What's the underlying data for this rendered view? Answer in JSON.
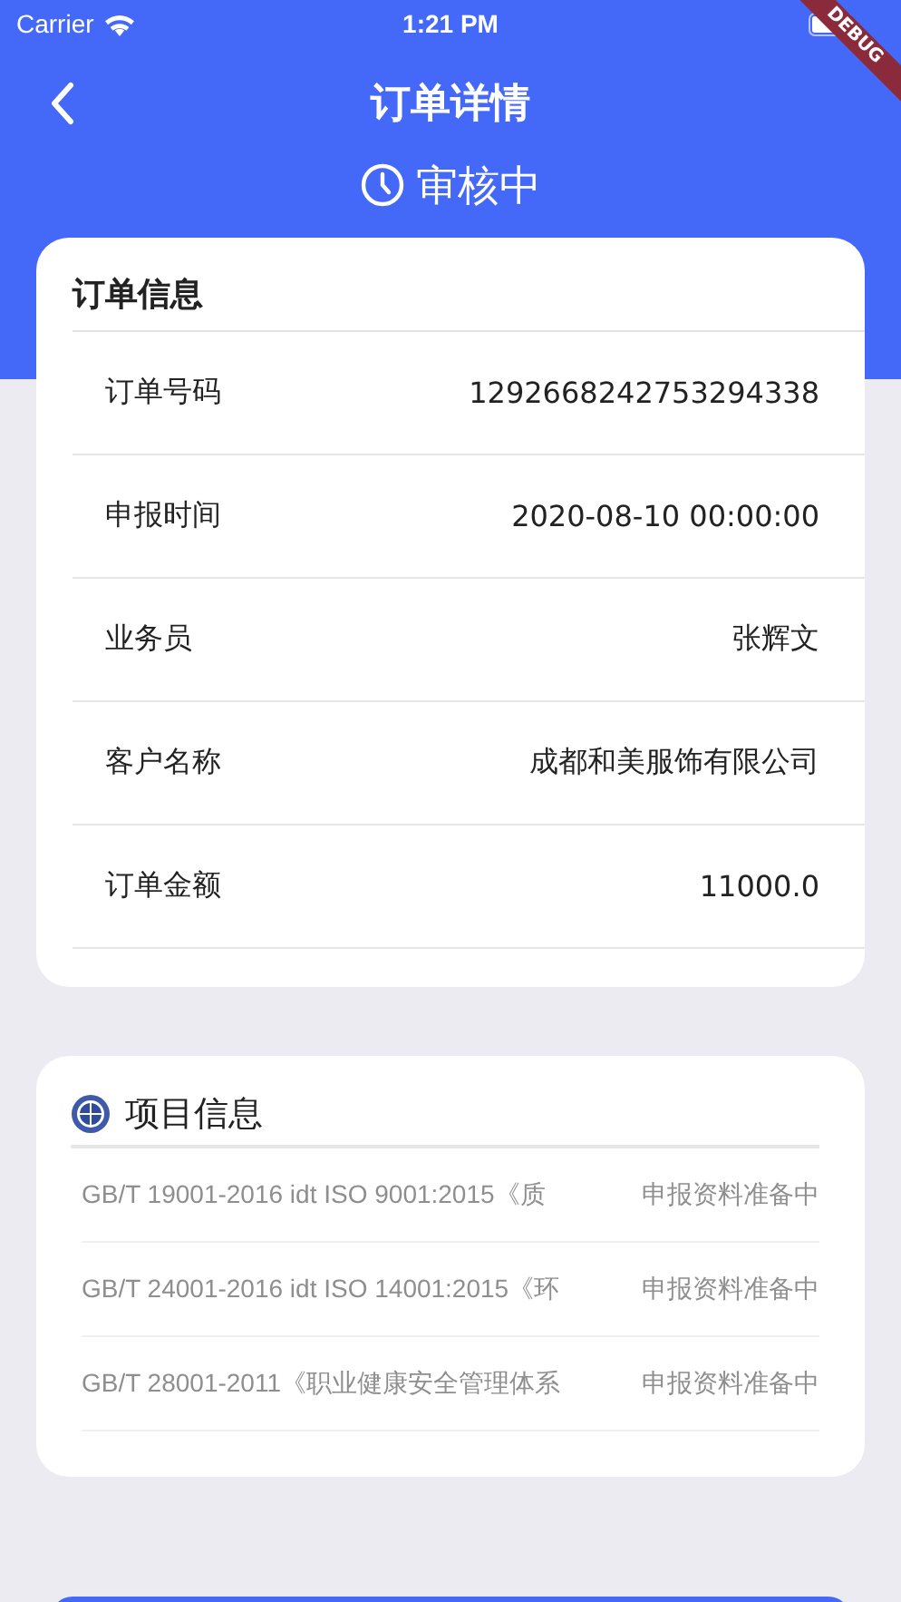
{
  "status_bar": {
    "carrier": "Carrier",
    "time": "1:21 PM"
  },
  "debug_banner": "DEBUG",
  "nav": {
    "title": "订单详情"
  },
  "order_status": "审核中",
  "order_info": {
    "title": "订单信息",
    "rows": [
      {
        "label": "订单号码",
        "value": "1292668242753294338"
      },
      {
        "label": "申报时间",
        "value": "2020-08-10 00:00:00"
      },
      {
        "label": "业务员",
        "value": "张辉文"
      },
      {
        "label": "客户名称",
        "value": "成都和美服饰有限公司"
      },
      {
        "label": "订单金额",
        "value": "11000.0"
      }
    ]
  },
  "project_info": {
    "title": "项目信息",
    "rows": [
      {
        "name": "GB/T 19001-2016 idt ISO 9001:2015《质",
        "status": "申报资料准备中"
      },
      {
        "name": "GB/T 24001-2016 idt ISO 14001:2015《环",
        "status": "申报资料准备中"
      },
      {
        "name": "GB/T 28001-2011《职业健康安全管理体系",
        "status": "申报资料准备中"
      }
    ]
  }
}
